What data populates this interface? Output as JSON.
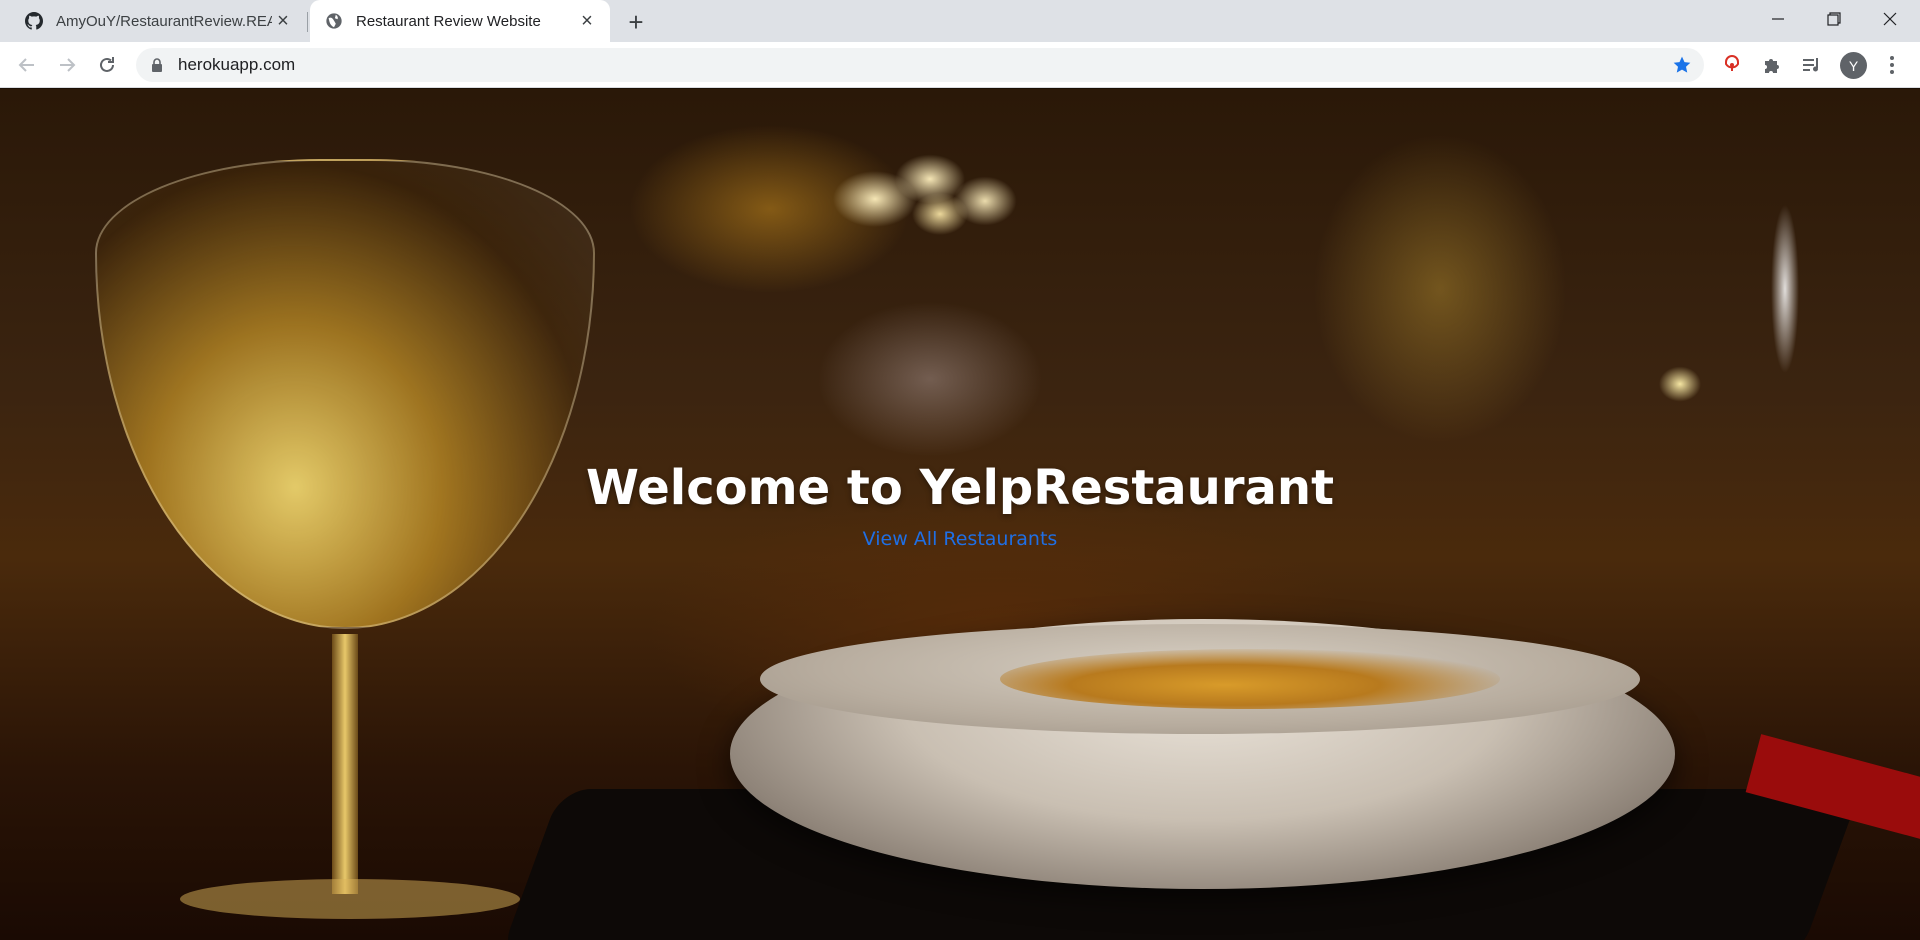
{
  "browser": {
    "tabs": [
      {
        "title": "AmyOuY/RestaurantReview.REACT",
        "icon": "github-icon",
        "active": false
      },
      {
        "title": "Restaurant Review Website",
        "icon": "globe-icon",
        "active": true
      }
    ],
    "address": "herokuapp.com",
    "profile_initial": "Y",
    "accent_color": "#1a73e8"
  },
  "hero": {
    "title": "Welcome to YelpRestaurant",
    "link_label": "View All Restaurants",
    "link_color": "#1f6fe5"
  }
}
